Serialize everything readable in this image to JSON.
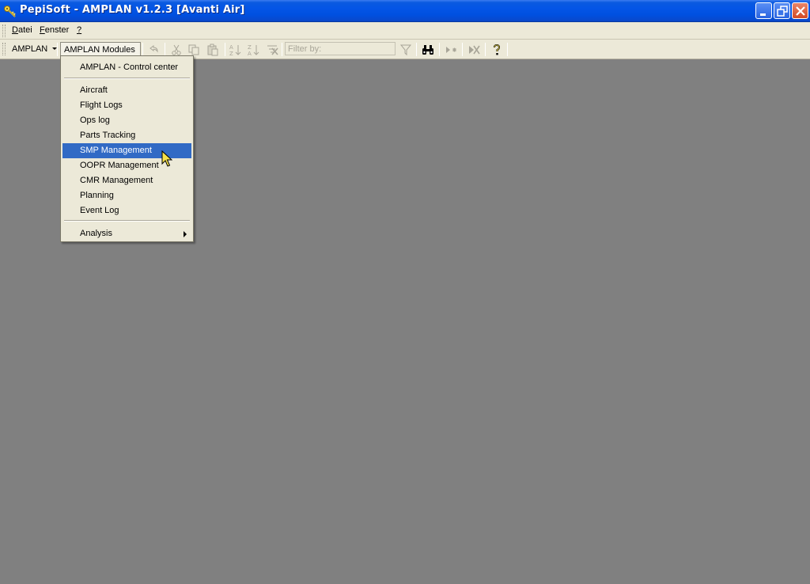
{
  "window": {
    "title": "PepiSoft - AMPLAN v1.2.3 [Avanti Air]"
  },
  "menubar": {
    "items": [
      {
        "label": "Datei",
        "accel": "D",
        "rest": "atei"
      },
      {
        "label": "Fenster",
        "accel": "F",
        "rest": "enster"
      },
      {
        "label": "?",
        "accel": "?",
        "rest": ""
      }
    ]
  },
  "toolbar": {
    "amplan_label": "AMPLAN",
    "modules_label": "AMPLAN Modules",
    "filter_placeholder": "Filter by:",
    "icons": [
      "undo-icon",
      "cut-icon",
      "copy-icon",
      "paste-icon",
      "sort-ascending-icon",
      "sort-descending-icon",
      "clear-sort-icon",
      "filter-icon",
      "binoculars-icon",
      "filter-selection-icon",
      "remove-filter-icon",
      "help-icon"
    ]
  },
  "modules_menu": {
    "control_center": "AMPLAN - Control center",
    "items": [
      "Aircraft",
      "Flight Logs",
      "Ops log",
      "Parts Tracking",
      "SMP Management",
      "OOPR Management",
      "CMR Management",
      "Planning",
      "Event Log"
    ],
    "highlighted": "SMP Management",
    "analysis": "Analysis"
  },
  "colors": {
    "titlebar": "#0455e6",
    "menu_highlight": "#316ac5",
    "workspace": "#808080",
    "chrome": "#ece9d8"
  }
}
